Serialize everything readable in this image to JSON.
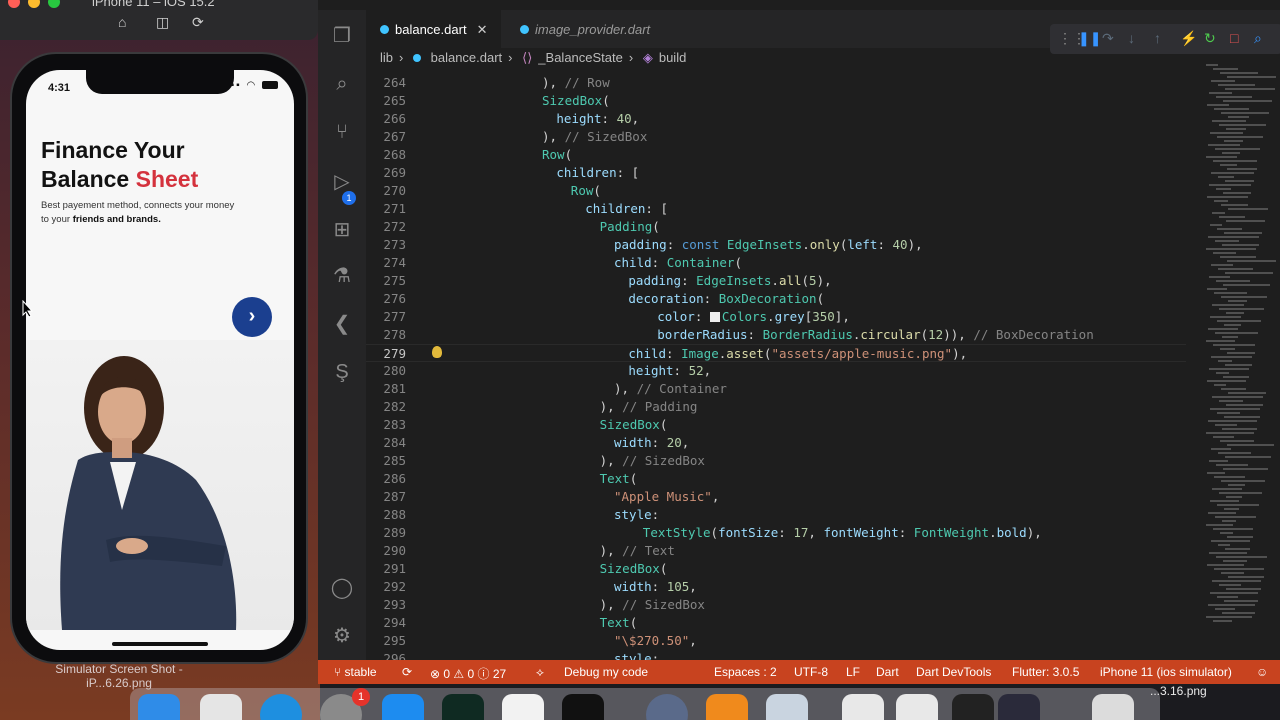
{
  "simulator": {
    "title": "iPhone 11 – iOS 15.2",
    "desktop_label": "Simulator Screen Shot - iP...6.26.png"
  },
  "phone": {
    "time": "4:31",
    "title_line1": "Finance Your",
    "title_line2_a": "Balance ",
    "title_line2_b": "Sheet",
    "subtitle_a": "Best payement method, connects your money to your ",
    "subtitle_b": "friends and brands.",
    "next_glyph": "›",
    "accent_color": "#d4323d",
    "button_color": "#1b3f8f"
  },
  "editor": {
    "tabs": [
      {
        "label": "balance.dart",
        "active": true
      },
      {
        "label": "image_provider.dart",
        "active": false
      }
    ],
    "breadcrumb": [
      "lib",
      "balance.dart",
      "_BalanceState",
      "build"
    ],
    "cursor_line": 279,
    "lines": [
      {
        "n": 264,
        "indent": 10,
        "html": "<span class='punc'>), </span><span class='c'>// Row</span>"
      },
      {
        "n": 265,
        "indent": 10,
        "html": "<span class='k'>SizedBox</span><span class='punc'>(</span>"
      },
      {
        "n": 266,
        "indent": 12,
        "html": "<span class='p'>height</span><span class='punc'>: </span><span class='n'>40</span><span class='punc'>,</span>"
      },
      {
        "n": 267,
        "indent": 10,
        "html": "<span class='punc'>), </span><span class='c'>// SizedBox</span>"
      },
      {
        "n": 268,
        "indent": 10,
        "html": "<span class='k'>Row</span><span class='punc'>(</span>"
      },
      {
        "n": 269,
        "indent": 12,
        "html": "<span class='p'>children</span><span class='punc'>: [</span>"
      },
      {
        "n": 270,
        "indent": 14,
        "html": "<span class='k'>Row</span><span class='punc'>(</span>"
      },
      {
        "n": 271,
        "indent": 16,
        "html": "<span class='p'>children</span><span class='punc'>: [</span>"
      },
      {
        "n": 272,
        "indent": 18,
        "html": "<span class='k'>Padding</span><span class='punc'>(</span>"
      },
      {
        "n": 273,
        "indent": 20,
        "html": "<span class='p'>padding</span><span class='punc'>: </span><span class='kw'>const</span> <span class='k'>EdgeInsets</span><span class='punc'>.</span><span class='f'>only</span><span class='punc'>(</span><span class='p'>left</span><span class='punc'>: </span><span class='n'>40</span><span class='punc'>),</span>"
      },
      {
        "n": 274,
        "indent": 20,
        "html": "<span class='p'>child</span><span class='punc'>: </span><span class='k'>Container</span><span class='punc'>(</span>"
      },
      {
        "n": 275,
        "indent": 22,
        "html": "<span class='p'>padding</span><span class='punc'>: </span><span class='k'>EdgeInsets</span><span class='punc'>.</span><span class='f'>all</span><span class='punc'>(</span><span class='n'>5</span><span class='punc'>),</span>"
      },
      {
        "n": 276,
        "indent": 22,
        "html": "<span class='p'>decoration</span><span class='punc'>: </span><span class='k'>BoxDecoration</span><span class='punc'>(</span>"
      },
      {
        "n": 277,
        "indent": 26,
        "html": "<span class='p'>color</span><span class='punc'>: </span><span class='swatch'></span><span class='k'>Colors</span><span class='punc'>.</span><span class='p'>grey</span><span class='punc'>[</span><span class='n'>350</span><span class='punc'>],</span>"
      },
      {
        "n": 278,
        "indent": 26,
        "html": "<span class='p'>borderRadius</span><span class='punc'>: </span><span class='k'>BorderRadius</span><span class='punc'>.</span><span class='f'>circular</span><span class='punc'>(</span><span class='n'>12</span><span class='punc'>)), </span><span class='c'>// BoxDecoration</span>"
      },
      {
        "n": 279,
        "indent": 22,
        "html": "<span class='p'>child</span><span class='punc'>: </span><span class='k'>Image</span><span class='punc'>.</span><span class='f'>asset</span><span class='punc'>(</span><span class='s'>\"assets/apple-music.png\"</span><span class='punc'>),</span>"
      },
      {
        "n": 280,
        "indent": 22,
        "html": "<span class='p'>height</span><span class='punc'>: </span><span class='n'>52</span><span class='punc'>,</span>"
      },
      {
        "n": 281,
        "indent": 20,
        "html": "<span class='punc'>), </span><span class='c'>// Container</span>"
      },
      {
        "n": 282,
        "indent": 18,
        "html": "<span class='punc'>), </span><span class='c'>// Padding</span>"
      },
      {
        "n": 283,
        "indent": 18,
        "html": "<span class='k'>SizedBox</span><span class='punc'>(</span>"
      },
      {
        "n": 284,
        "indent": 20,
        "html": "<span class='p'>width</span><span class='punc'>: </span><span class='n'>20</span><span class='punc'>,</span>"
      },
      {
        "n": 285,
        "indent": 18,
        "html": "<span class='punc'>), </span><span class='c'>// SizedBox</span>"
      },
      {
        "n": 286,
        "indent": 18,
        "html": "<span class='k'>Text</span><span class='punc'>(</span>"
      },
      {
        "n": 287,
        "indent": 20,
        "html": "<span class='s'>\"Apple Music\"</span><span class='punc'>,</span>"
      },
      {
        "n": 288,
        "indent": 20,
        "html": "<span class='p'>style</span><span class='punc'>:</span>"
      },
      {
        "n": 289,
        "indent": 24,
        "html": "<span class='k'>TextStyle</span><span class='punc'>(</span><span class='p'>fontSize</span><span class='punc'>: </span><span class='n'>17</span><span class='punc'>, </span><span class='p'>fontWeight</span><span class='punc'>: </span><span class='k'>FontWeight</span><span class='punc'>.</span><span class='p'>bold</span><span class='punc'>),</span>"
      },
      {
        "n": 290,
        "indent": 18,
        "html": "<span class='punc'>), </span><span class='c'>// Text</span>"
      },
      {
        "n": 291,
        "indent": 18,
        "html": "<span class='k'>SizedBox</span><span class='punc'>(</span>"
      },
      {
        "n": 292,
        "indent": 20,
        "html": "<span class='p'>width</span><span class='punc'>: </span><span class='n'>105</span><span class='punc'>,</span>"
      },
      {
        "n": 293,
        "indent": 18,
        "html": "<span class='punc'>), </span><span class='c'>// SizedBox</span>"
      },
      {
        "n": 294,
        "indent": 18,
        "html": "<span class='k'>Text</span><span class='punc'>(</span>"
      },
      {
        "n": 295,
        "indent": 20,
        "html": "<span class='s'>\"\\$270.50\"</span><span class='punc'>,</span>"
      },
      {
        "n": 296,
        "indent": 20,
        "html": "<span class='p'>style</span><span class='punc'>:</span>"
      }
    ]
  },
  "statusbar": {
    "branch": "stable",
    "errors": "0",
    "warnings": "0",
    "infos": "27",
    "debug": "Debug my code",
    "spaces": "Espaces : 2",
    "encoding": "UTF-8",
    "eol": "LF",
    "language": "Dart",
    "devtools": "Dart DevTools",
    "flutter": "Flutter: 3.0.5",
    "device": "iPhone 11 (ios simulator)",
    "color": "#c8431f"
  },
  "dock": {
    "badge": "1",
    "file_label": "...3.16.png"
  }
}
